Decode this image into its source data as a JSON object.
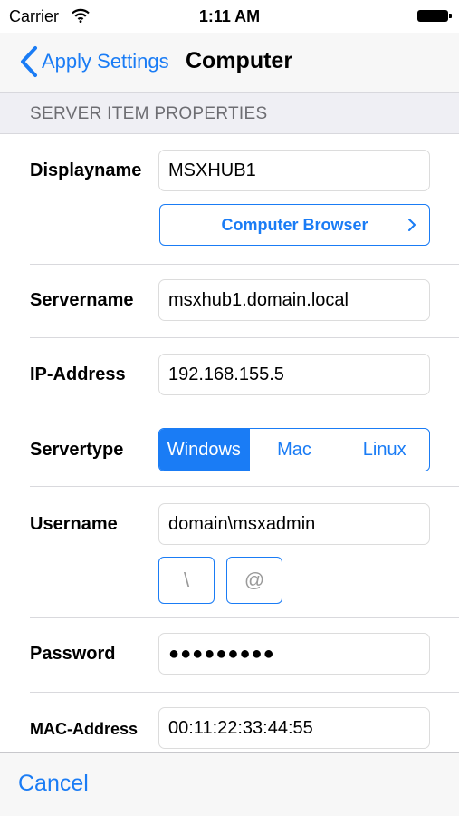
{
  "status_bar": {
    "carrier": "Carrier",
    "time": "1:11 AM"
  },
  "nav": {
    "back_label": "Apply Settings",
    "title": "Computer"
  },
  "section": {
    "header": "SERVER ITEM PROPERTIES"
  },
  "form": {
    "displayname": {
      "label": "Displayname",
      "value": "MSXHUB1"
    },
    "computer_browser_label": "Computer Browser",
    "servername": {
      "label": "Servername",
      "value": "msxhub1.domain.local"
    },
    "ip_address": {
      "label": "IP-Address",
      "value": "192.168.155.5"
    },
    "servertype": {
      "label": "Servertype",
      "options": [
        "Windows",
        "Mac",
        "Linux"
      ],
      "selected": "Windows"
    },
    "username": {
      "label": "Username",
      "value": "domain\\msxadmin",
      "insert_buttons": [
        "\\",
        "@"
      ]
    },
    "password": {
      "label": "Password",
      "value": "●●●●●●●●●"
    },
    "mac_address": {
      "label": "MAC-Address",
      "value": "00:11:22:33:44:55"
    }
  },
  "toolbar": {
    "cancel_label": "Cancel"
  },
  "colors": {
    "accent": "#1a7cf5",
    "section_bg": "#efeff4",
    "section_text": "#6d6d72"
  }
}
